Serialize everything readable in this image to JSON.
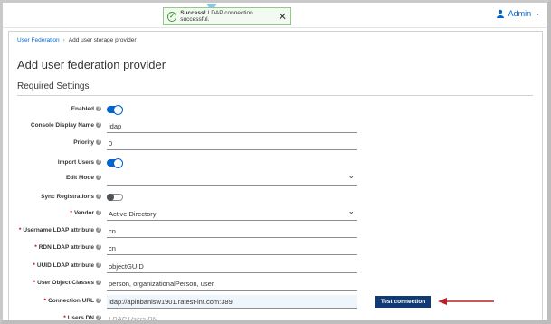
{
  "topbar": {
    "user": "Admin"
  },
  "toast": {
    "bold": "Success!",
    "message": "LDAP connection successful."
  },
  "breadcrumb": {
    "link": "User Federation",
    "current": "Add user storage provider"
  },
  "page": {
    "title": "Add user federation provider",
    "section": "Required Settings"
  },
  "form": {
    "enabled": {
      "label": "Enabled",
      "value": "on"
    },
    "display_name": {
      "label": "Console Display Name",
      "value": "ldap"
    },
    "priority": {
      "label": "Priority",
      "value": "0"
    },
    "import_users": {
      "label": "Import Users",
      "value": "on"
    },
    "edit_mode": {
      "label": "Edit Mode",
      "value": ""
    },
    "sync_registrations": {
      "label": "Sync Registrations",
      "value": "off"
    },
    "vendor": {
      "label": "Vendor",
      "value": "Active Directory"
    },
    "username_attr": {
      "label": "Username LDAP attribute",
      "value": "cn"
    },
    "rdn_attr": {
      "label": "RDN LDAP attribute",
      "value": "cn"
    },
    "uuid_attr": {
      "label": "UUID LDAP attribute",
      "value": "objectGUID"
    },
    "object_classes": {
      "label": "User Object Classes",
      "value": "person, organizationalPerson, user"
    },
    "connection_url": {
      "label": "Connection URL",
      "value": "ldap://apinbanisw1901.ratest-int.com:389"
    },
    "users_dn": {
      "label": "Users DN",
      "placeholder": "LDAP Users DN"
    }
  },
  "buttons": {
    "test_connection": "Test connection"
  },
  "colors": {
    "primary": "#0066cc",
    "button": "#0f3a73",
    "arrow": "#b52026",
    "success": "#3f9c35"
  }
}
